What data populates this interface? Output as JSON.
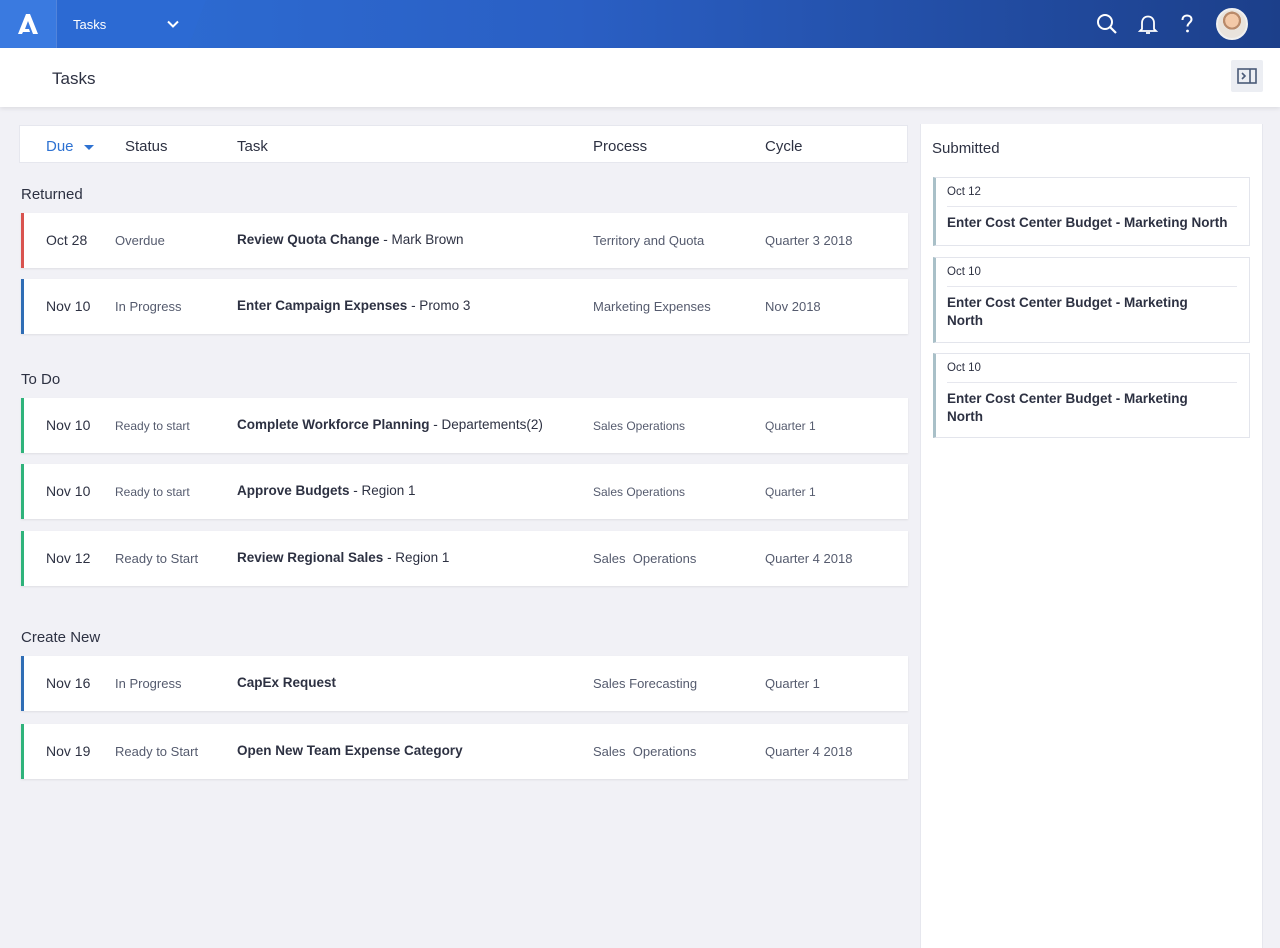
{
  "topbar": {
    "app_name": "Tasks",
    "icons": [
      "search-icon",
      "bell-icon",
      "help-icon"
    ]
  },
  "page": {
    "title": "Tasks"
  },
  "table": {
    "headers": {
      "due": "Due",
      "status": "Status",
      "task": "Task",
      "process": "Process",
      "cycle": "Cycle"
    }
  },
  "sections": [
    {
      "title": "Returned",
      "rows": [
        {
          "due": "Oct 28",
          "status": "Overdue",
          "task_bold": "Review Quota Change",
          "task_rest": " - Mark Brown",
          "process": "Territory and Quota",
          "cycle": "Quarter 3 2018",
          "accent": "red"
        },
        {
          "due": "Nov 10",
          "status": "In Progress",
          "task_bold": "Enter Campaign Expenses",
          "task_rest": " - Promo 3",
          "process": "Marketing Expenses",
          "cycle": "Nov 2018",
          "accent": "blue"
        }
      ]
    },
    {
      "title": "To Do",
      "rows": [
        {
          "due": "Nov 10",
          "status": "Ready to start",
          "task_bold": "Complete Workforce Planning",
          "task_rest": " - Departements(2)",
          "process": "Sales Operations",
          "cycle": "Quarter 1",
          "accent": "green"
        },
        {
          "due": "Nov 10",
          "status": "Ready to start",
          "task_bold": "Approve Budgets",
          "task_rest": " - Region 1",
          "process": "Sales Operations",
          "cycle": "Quarter 1",
          "accent": "green"
        },
        {
          "due": "Nov 12",
          "status": "Ready to Start",
          "task_bold": "Review Regional Sales",
          "task_rest": " - Region 1",
          "process": "Sales  Operations",
          "cycle": "Quarter 4 2018",
          "accent": "green"
        }
      ]
    },
    {
      "title": "Create New",
      "rows": [
        {
          "due": "Nov 16",
          "status": "In Progress",
          "task_bold": "CapEx Request",
          "task_rest": "",
          "process": "Sales Forecasting",
          "cycle": "Quarter 1",
          "accent": "blue"
        },
        {
          "due": "Nov 19",
          "status": "Ready to Start",
          "task_bold": "Open New Team Expense Category",
          "task_rest": "",
          "process": "Sales  Operations",
          "cycle": "Quarter 4 2018",
          "accent": "green"
        }
      ]
    }
  ],
  "submitted": {
    "title": "Submitted",
    "cards": [
      {
        "date": "Oct 12",
        "title": "Enter Cost Center Budget - Marketing North"
      },
      {
        "date": "Oct 10",
        "title": "Enter Cost Center Budget - Marketing North"
      },
      {
        "date": "Oct 10",
        "title": "Enter Cost Center Budget - Marketing North"
      }
    ]
  },
  "colors": {
    "brand": "#2e6fd6",
    "returned": "#d9534f",
    "in_progress": "#2f6db5",
    "ready": "#2fb37b"
  }
}
